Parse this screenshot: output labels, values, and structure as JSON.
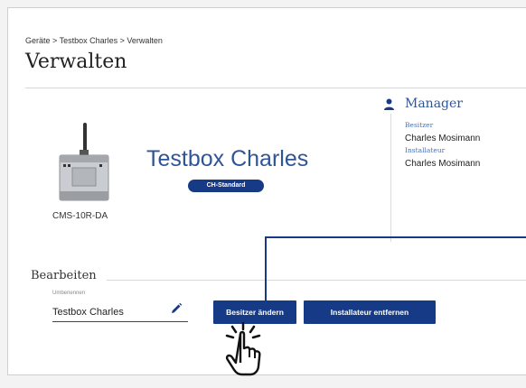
{
  "breadcrumb": "Geräte > Testbox Charles > Verwalten",
  "page_title": "Verwalten",
  "device": {
    "name": "Testbox Charles",
    "model": "CMS-10R-DA",
    "badge": "CH-Standard"
  },
  "manager": {
    "title": "Manager",
    "owner_label": "Besitzer",
    "owner_name": "Charles Mosimann",
    "installer_label": "Installateur",
    "installer_name": "Charles Mosimann"
  },
  "edit_section": {
    "title": "Bearbeiten",
    "rename_label": "Umbenennen",
    "rename_value": "Testbox Charles"
  },
  "buttons": {
    "change_owner": "Besitzer ändern",
    "remove_installer": "Installateur entfernen"
  },
  "colors": {
    "brand_blue": "#173a87",
    "title_blue": "#2f5597"
  },
  "icons": [
    "person-icon",
    "pencil-icon",
    "tap-hand-icon",
    "device-icon"
  ]
}
